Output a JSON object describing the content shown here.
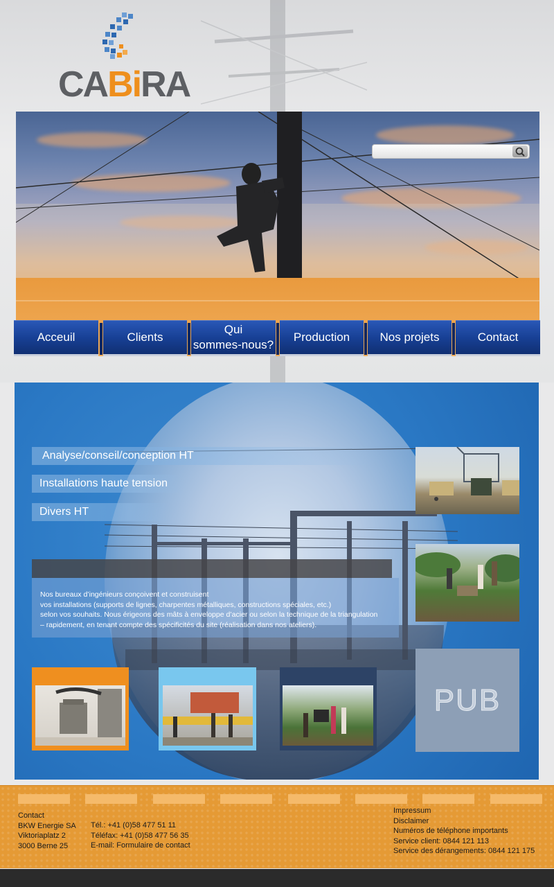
{
  "brand": {
    "logo_text_left": "CA",
    "logo_text_accent": "Bi",
    "logo_text_right": "RA"
  },
  "search": {
    "placeholder": ""
  },
  "nav": {
    "items": [
      {
        "label": "Acceuil"
      },
      {
        "label": "Clients"
      },
      {
        "label": "Qui\nsommes-nous?"
      },
      {
        "label": "Production"
      },
      {
        "label": "Nos projets"
      },
      {
        "label": "Contact"
      }
    ]
  },
  "services": [
    {
      "label": "Analyse/conseil/conception HT"
    },
    {
      "label": "Installations haute tension"
    },
    {
      "label": "Divers HT"
    }
  ],
  "description": {
    "lines": [
      "Nos bureaux d’ingénieurs conçoivent et construisent",
      "vos installations (supports de lignes, charpentes métalliques, constructions spéciales, etc.)",
      "selon vos souhaits. Nous érigeons des mâts à enveloppe d’acier ou selon la technique de la triangulation",
      "– rapidement, en tenant compte des spécificités du site (réalisation dans nos ateliers)."
    ]
  },
  "pub": {
    "label": "PUB"
  },
  "footer": {
    "contact": [
      "Contact",
      "BKW Energie SA",
      "Viktoriaplatz 2",
      "3000 Berne 25"
    ],
    "phones": [
      "Tél.: +41 (0)58 477 51 11",
      "Téléfax: +41 (0)58 477 56 35",
      "E-mail: Formulaire de contact"
    ],
    "links": [
      "Impressum",
      "Disclaimer",
      "Numéros de téléphone importants",
      "Service client: 0844 121 113",
      "Service des dérangements: 0844 121 175"
    ]
  },
  "colors": {
    "accent": "#ee8f1d",
    "nav": "#173f93",
    "main_bg": "#2a78c4",
    "footer": "#e59a35"
  }
}
